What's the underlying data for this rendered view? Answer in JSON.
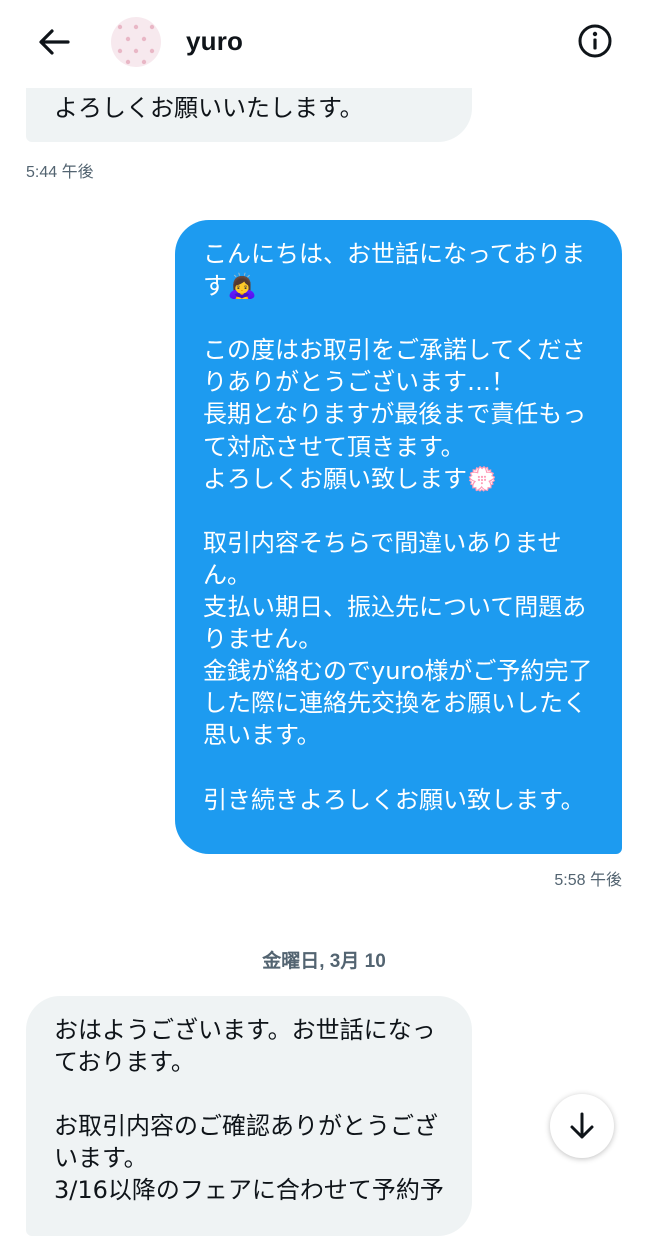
{
  "header": {
    "title": "yuro",
    "back_icon": "arrow-left-icon",
    "info_icon": "info-circle-icon",
    "avatar_color": "#f7e9ee"
  },
  "messages": [
    {
      "direction": "received",
      "text": "よろしくお願いいたします。",
      "time": "5:44 午後"
    },
    {
      "direction": "sent",
      "text": "こんにちは、お世話になっておりま\nす🙇‍♀️\n\nこの度はお取引をご承諾してくださ\nりありがとうございます…！\n長期となりますが最後まで責任もっ\nて対応させて頂きます。\nよろしくお願い致します💮\n\n取引内容そちらで間違いありませ\nん。\n支払い期日、振込先について問題あ\nりません。\n金銭が絡むのでyuro様がご予約完了\nした際に連絡先交換をお願いしたく\n思います。\n\n引き続きよろしくお願い致します。",
      "time": "5:58 午後"
    },
    {
      "direction": "received",
      "text": "おはようございます。お世話になっ\nております。\n\nお取引内容のご確認ありがとうござ\nいます。\n3/16以降のフェアに合わせて予約予"
    }
  ],
  "date_separator": "金曜日, 3月 10",
  "scroll_button_icon": "arrow-down-icon",
  "colors": {
    "sent_bubble": "#1d9bf0",
    "received_bubble": "#eff3f4",
    "timestamp": "#536471"
  }
}
